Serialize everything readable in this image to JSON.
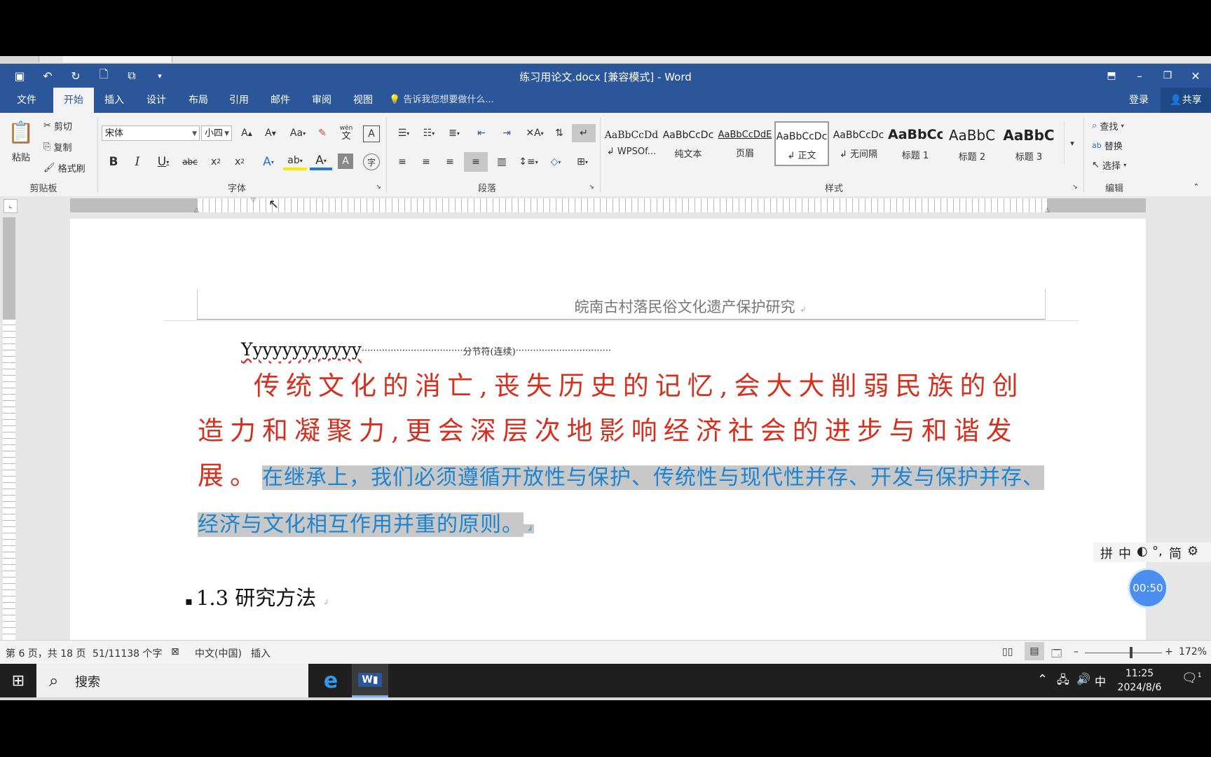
{
  "title_bar": {
    "title": "练习用论文.docx [兼容模式] - Word",
    "qat_icons": [
      "save-icon",
      "undo-icon",
      "redo-icon",
      "new-doc-icon",
      "print-layout-icon",
      "customize-icon"
    ],
    "window_controls": [
      "ribbon-display-icon",
      "minimize-icon",
      "restore-icon",
      "close-icon"
    ]
  },
  "tabs": [
    "文件",
    "开始",
    "插入",
    "设计",
    "布局",
    "引用",
    "邮件",
    "审阅",
    "视图"
  ],
  "active_tab": "开始",
  "tell_me": "告诉我您想要做什么...",
  "account": {
    "login": "登录",
    "share": "共享"
  },
  "clipboard": {
    "paste": "粘贴",
    "cut": "剪切",
    "copy": "复制",
    "format_painter": "格式刷",
    "label": "剪贴板"
  },
  "font": {
    "name": "宋体",
    "size": "小四",
    "label": "字体",
    "case": "Aa",
    "phonetic_top": "wén",
    "phonetic": "文"
  },
  "paragraph": {
    "label": "段落"
  },
  "styles": {
    "label": "样式",
    "items": [
      {
        "preview": "AaBbCcDd",
        "name": "↲ WPSOf..."
      },
      {
        "preview": "AaBbCcDc",
        "name": "纯文本"
      },
      {
        "preview": "AaBbCcDdE",
        "name": "页眉"
      },
      {
        "preview": "AaBbCcDc",
        "name": "↲ 正文"
      },
      {
        "preview": "AaBbCcDc",
        "name": "↲ 无间隔"
      },
      {
        "preview": "AaBbCc",
        "name": "标题 1"
      },
      {
        "preview": "AaBbC",
        "name": "标题 2"
      },
      {
        "preview": "AaBbC",
        "name": "标题 3"
      }
    ]
  },
  "editing": {
    "find": "查找",
    "replace": "替换",
    "select": "选择",
    "label": "编辑"
  },
  "document": {
    "header": "皖南古村落民俗文化遗产保护研究",
    "y_line": "Yyyyyyyyyyyy",
    "section_break": "分节符(连续)",
    "red_text": "传统文化的消亡,丧失历史的记忆,会大大削弱民族的创造力和凝聚力,更会深层次地影响经济社会的进步与和谐发展。",
    "blue_text": "在继承上，我们必须遵循开放性与保护、传统性与现代性并存、开发与保护并存、经济与文化相互作用并重的原则。",
    "heading": "1.3 研究方法"
  },
  "ime_bar": [
    "拼",
    "中",
    "◐",
    "°,",
    "简",
    "⚙"
  ],
  "timer": "00:50",
  "status": {
    "page": "第 6 页，共 18 页",
    "words": "51/11138 个字",
    "lang": "中文(中国)",
    "mode": "插入",
    "zoom": "172%",
    "zoom_level": 0.6
  },
  "taskbar": {
    "search": "搜索",
    "ime": "中",
    "time": "11:25",
    "date": "2024/8/6",
    "notifications": "1"
  },
  "colors": {
    "word_blue": "#2b579a",
    "red_text": "#d3301f",
    "blue_text": "#1e84d0"
  }
}
